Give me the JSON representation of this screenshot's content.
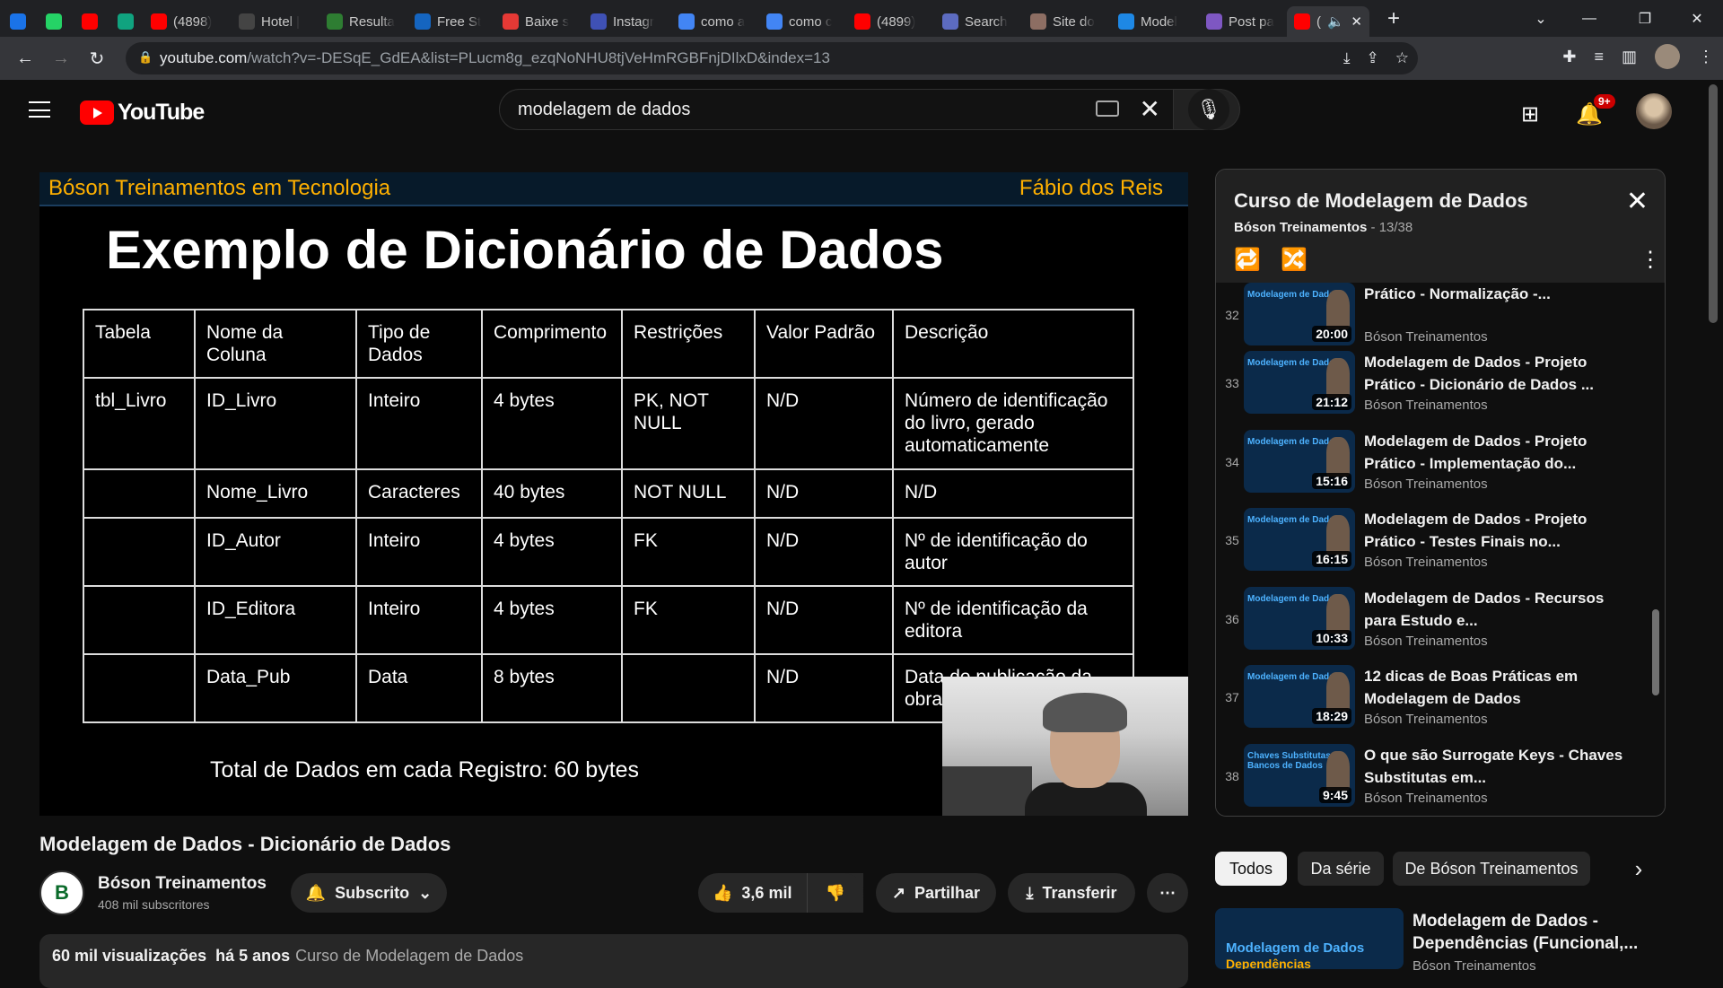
{
  "browser": {
    "tabs": [
      {
        "title": "",
        "favicon": "shield-icon",
        "color": "#1a73e8"
      },
      {
        "title": "",
        "favicon": "whatsapp-icon",
        "color": "#25d366"
      },
      {
        "title": "",
        "favicon": "youtube-icon",
        "color": "#ff0000"
      },
      {
        "title": "",
        "favicon": "chatgpt-icon",
        "color": "#10a37f"
      },
      {
        "title": "(4898)",
        "favicon": "youtube-icon",
        "color": "#ff0000"
      },
      {
        "title": "Hotel |",
        "favicon": "hotel-icon",
        "color": "#444444"
      },
      {
        "title": "Resulta",
        "favicon": "check-icon",
        "color": "#2e7d32"
      },
      {
        "title": "Free St",
        "favicon": "v-icon",
        "color": "#1565c0"
      },
      {
        "title": "Baixe s",
        "favicon": "opera-icon",
        "color": "#e53935"
      },
      {
        "title": "Instagr",
        "favicon": "flag-icon",
        "color": "#3f51b5"
      },
      {
        "title": "como a",
        "favicon": "google-icon",
        "color": "#4285f4"
      },
      {
        "title": "como c",
        "favicon": "google-icon",
        "color": "#4285f4"
      },
      {
        "title": "(4899)",
        "favicon": "youtube-icon",
        "color": "#ff0000"
      },
      {
        "title": "Search",
        "favicon": "search-ai-icon",
        "color": "#5c6bc0"
      },
      {
        "title": "Site do",
        "favicon": "person-icon",
        "color": "#8d6e63"
      },
      {
        "title": "Model",
        "favicon": "c-icon",
        "color": "#1e88e5"
      },
      {
        "title": "Post pa",
        "favicon": "heart-shield-icon",
        "color": "#7e57c2"
      }
    ],
    "active_tab": {
      "title": "(",
      "favicon": "youtube-icon"
    },
    "url_host": "youtube.com",
    "url_path": "/watch?v=-DESqE_GdEA&list=PLucm8g_ezqNoNHU8tjVeHmRGBFnjDIlxD&index=13"
  },
  "youtube": {
    "logo_text": "YouTube",
    "search_value": "modelagem de dados",
    "notifications_badge": "9+"
  },
  "slide": {
    "header_left": "Bóson Treinamentos em Tecnologia",
    "header_right": "Fábio dos Reis",
    "title": "Exemplo de Dicionário de Dados",
    "columns": [
      "Tabela",
      "Nome da Coluna",
      "Tipo de Dados",
      "Comprimento",
      "Restrições",
      "Valor Padrão",
      "Descrição"
    ],
    "rows": [
      [
        "tbl_Livro",
        "ID_Livro",
        "Inteiro",
        "4 bytes",
        "PK, NOT NULL",
        "N/D",
        "Número de identificação do livro, gerado automaticamente"
      ],
      [
        "",
        "Nome_Livro",
        "Caracteres",
        "40 bytes",
        "NOT NULL",
        "N/D",
        "N/D"
      ],
      [
        "",
        "ID_Autor",
        "Inteiro",
        "4 bytes",
        "FK",
        "N/D",
        "Nº de identificação do autor"
      ],
      [
        "",
        "ID_Editora",
        "Inteiro",
        "4 bytes",
        "FK",
        "N/D",
        "Nº de identificação da editora"
      ],
      [
        "",
        "Data_Pub",
        "Data",
        "8 bytes",
        "",
        "N/D",
        "Data de publicação da obra"
      ]
    ],
    "total": "Total de Dados em cada Registro: 60 bytes"
  },
  "video": {
    "title": "Modelagem de Dados - Dicionário de Dados",
    "channel": "Bóson Treinamentos",
    "subscribers": "408 mil subscritores",
    "subscribe_label": "Subscrito",
    "likes": "3,6 mil",
    "share_label": "Partilhar",
    "download_label": "Transferir",
    "views": "60 mil visualizações",
    "age": "há 5 anos",
    "playlist_link": "Curso de Modelagem de Dados"
  },
  "playlist": {
    "title": "Curso de Modelagem de Dados",
    "channel": "Bóson Treinamentos",
    "position": "- 13/38",
    "items": [
      {
        "n": "32",
        "title": "Prático - Normalização -...",
        "thumb": "Modelagem de Dados",
        "duration": "20:00",
        "channel": "Bóson Treinamentos"
      },
      {
        "n": "33",
        "title": "Modelagem de Dados - Projeto Prático - Dicionário de Dados ...",
        "thumb": "Modelagem de Dados",
        "duration": "21:12",
        "channel": "Bóson Treinamentos"
      },
      {
        "n": "34",
        "title": "Modelagem de Dados - Projeto Prático - Implementação do...",
        "thumb": "Modelagem de Dados",
        "duration": "15:16",
        "channel": "Bóson Treinamentos"
      },
      {
        "n": "35",
        "title": "Modelagem de Dados - Projeto Prático - Testes Finais no...",
        "thumb": "Modelagem de Dados",
        "duration": "16:15",
        "channel": "Bóson Treinamentos"
      },
      {
        "n": "36",
        "title": "Modelagem de Dados - Recursos para Estudo e...",
        "thumb": "Modelagem de Dados",
        "duration": "10:33",
        "channel": "Bóson Treinamentos"
      },
      {
        "n": "37",
        "title": "12 dicas de Boas Práticas em Modelagem de Dados",
        "thumb": "Modelagem de Dados",
        "duration": "18:29",
        "channel": "Bóson Treinamentos"
      },
      {
        "n": "38",
        "title": "O que são Surrogate Keys - Chaves Substitutas em...",
        "thumb": "Chaves Substitutas em Bancos de Dados",
        "duration": "9:45",
        "channel": "Bóson Treinamentos"
      }
    ]
  },
  "chips": [
    "Todos",
    "Da série",
    "De Bóson Treinamentos"
  ],
  "recommended": {
    "title": "Modelagem de Dados - Dependências (Funcional,...",
    "channel": "Bóson Treinamentos",
    "thumb_title": "Modelagem de Dados",
    "thumb_sub": "Dependências"
  }
}
